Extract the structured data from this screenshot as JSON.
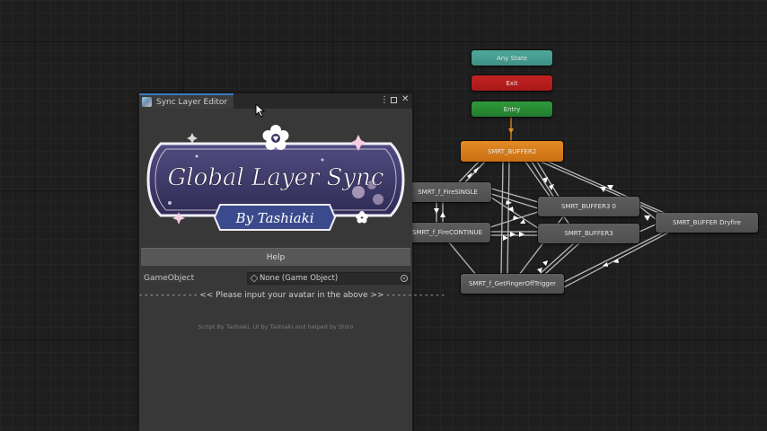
{
  "graph": {
    "nodes": [
      {
        "id": "any",
        "label": "Any State",
        "style": "any"
      },
      {
        "id": "exit",
        "label": "Exit",
        "style": "exit"
      },
      {
        "id": "entry",
        "label": "Entry",
        "style": "entry"
      },
      {
        "id": "buffer2",
        "label": "SMRT_BUFFER2",
        "style": "default"
      },
      {
        "id": "firesingle",
        "label": "SMRT_f_FireSINGLE",
        "style": "gray"
      },
      {
        "id": "firecontinue",
        "label": "SMRT_f_FireCONTINUE",
        "style": "gray"
      },
      {
        "id": "buffer30",
        "label": "SMRT_BUFFER3 0",
        "style": "gray"
      },
      {
        "id": "buffer3",
        "label": "SMRT_BUFFER3",
        "style": "gray"
      },
      {
        "id": "dryfire",
        "label": "SMRT_BUFFER Dryfire",
        "style": "gray"
      },
      {
        "id": "fingeroff",
        "label": "SMRT_f_GetFingerOffTrigger",
        "style": "gray"
      }
    ]
  },
  "editor": {
    "tab_title": "Sync Layer Editor",
    "menu_icon": "kebab-menu-icon",
    "maximize_icon": "maximize-icon",
    "close_icon": "close-icon",
    "banner": {
      "title": "Global Layer Sync",
      "subtitle": "By Tashiaki",
      "colors": {
        "panel": "#3b3763",
        "frame": "#f2eef7",
        "ribbon": "#3a4a8c",
        "blossom": "#f4e6f4"
      }
    },
    "help_label": "Help",
    "gameobject_label": "GameObject",
    "gameobject_value": "None (Game Object)",
    "notice": "- - - - - - - - - - - << Please input your avatar in the above >> - - - - - - - - - - -",
    "credit": "Script By Tashiaki, UI by Tashiaki and helped by Shiro"
  },
  "colors": {
    "accent": "#3a79bb",
    "any_state": "#4ea89b",
    "exit": "#c42222",
    "entry": "#2e9a3a",
    "default_state": "#e38b26"
  }
}
